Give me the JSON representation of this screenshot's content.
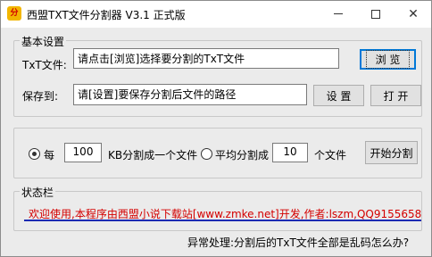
{
  "window": {
    "title": "西盟TXT文件分割器 V3.1 正式版",
    "icon_text": "分",
    "controls": {
      "minimize": "minimize-icon",
      "maximize": "maximize-icon",
      "close": "✕"
    }
  },
  "settings": {
    "group_label": "基本设置",
    "txt_label": "TxT文件:",
    "txt_value": "请点击[浏览]选择要分割的TxT文件",
    "browse_button": "浏 览",
    "save_label": "保存到:",
    "save_value": "请[设置]要保存分割后文件的路径",
    "set_button": "设 置",
    "open_button": "打 开"
  },
  "split": {
    "per_label": "每",
    "per_value": "100",
    "per_suffix": "KB分割成一个文件",
    "avg_label": "平均分割成",
    "avg_value": "10",
    "avg_suffix": "个文件",
    "start_button": "开始分割",
    "selected_mode": "per_kb"
  },
  "status": {
    "group_label": "状态栏",
    "message": "欢迎使用,本程序由西盟小说下载站[www.zmke.net]开发,作者:lszm,QQ9155658",
    "message_color": "#d40000"
  },
  "footer": {
    "faq_link": "异常处理:分割后的TxT文件全部是乱码怎么办?"
  }
}
